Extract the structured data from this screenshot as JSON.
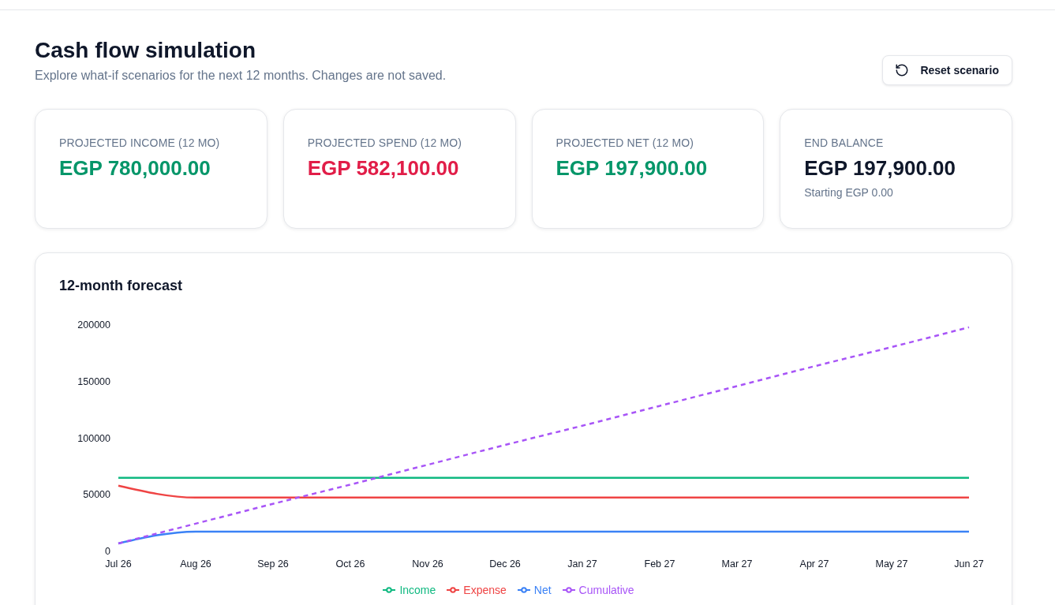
{
  "header": {
    "title": "Cash flow simulation",
    "subtitle": "Explore what-if scenarios for the next 12 months. Changes are not saved.",
    "reset_button": "Reset scenario"
  },
  "stats": [
    {
      "label": "PROJECTED INCOME (12 MO)",
      "value": "EGP 780,000.00",
      "color": "#059669"
    },
    {
      "label": "PROJECTED SPEND (12 MO)",
      "value": "EGP 582,100.00",
      "color": "#e11d48"
    },
    {
      "label": "PROJECTED NET (12 MO)",
      "value": "EGP 197,900.00",
      "color": "#059669"
    },
    {
      "label": "END BALANCE",
      "value": "EGP 197,900.00",
      "color": "#0f172a",
      "note": "Starting EGP 0.00"
    }
  ],
  "forecast": {
    "chart_data": {
      "type": "line",
      "title": "12-month forecast",
      "categories": [
        "Jul 26",
        "Aug 26",
        "Sep 26",
        "Oct 26",
        "Nov 26",
        "Dec 26",
        "Jan 27",
        "Feb 27",
        "Mar 27",
        "Apr 27",
        "May 27",
        "Jun 27"
      ],
      "ylim": [
        0,
        200000
      ],
      "yticks": [
        0,
        50000,
        100000,
        150000,
        200000
      ],
      "legend": "bottom",
      "series": [
        {
          "name": "Income",
          "color": "#10b981",
          "values": [
            65000,
            65000,
            65000,
            65000,
            65000,
            65000,
            65000,
            65000,
            65000,
            65000,
            65000,
            65000
          ]
        },
        {
          "name": "Expense",
          "color": "#ef4444",
          "values": [
            58000,
            47500,
            47500,
            47500,
            47500,
            47500,
            47500,
            47500,
            47500,
            47500,
            47500,
            47500
          ]
        },
        {
          "name": "Net",
          "color": "#3b82f6",
          "values": [
            7000,
            17500,
            17500,
            17500,
            17500,
            17500,
            17500,
            17500,
            17500,
            17500,
            17500,
            17500
          ]
        },
        {
          "name": "Cumulative",
          "color": "#a855f7",
          "line_style": "dashed",
          "values": [
            7000,
            24500,
            42000,
            59000,
            76500,
            94000,
            111000,
            128500,
            146000,
            163500,
            180500,
            198000
          ]
        }
      ]
    }
  }
}
